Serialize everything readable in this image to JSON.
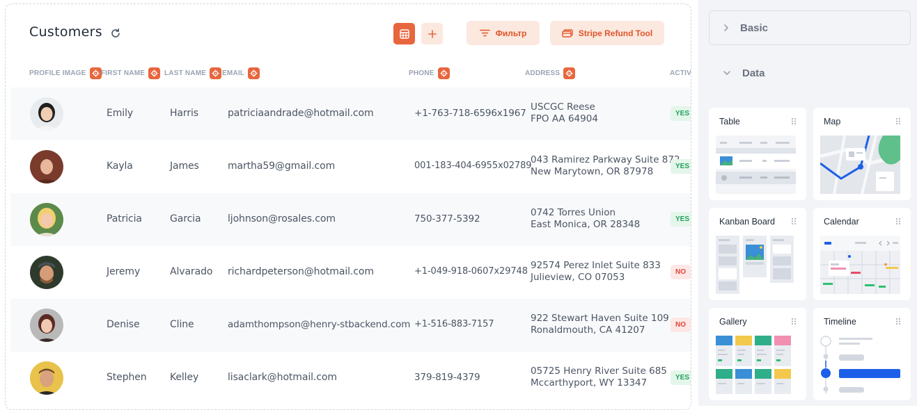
{
  "header": {
    "title": "Customers",
    "filter_label": "Фильтр",
    "stripe_label": "Stripe Refund Tool"
  },
  "table": {
    "columns": [
      "PROFILE IMAGE",
      "FIRST NAME",
      "LAST NAME",
      "EMAIL",
      "PHONE",
      "ADDRESS",
      "ACTIV"
    ],
    "rows": [
      {
        "first": "Emily",
        "last": "Harris",
        "email": "patriciaandrade@hotmail.com",
        "phone": "+1-763-718-6596x1967",
        "addr1": "USCGC Reese",
        "addr2": "FPO AA 64904",
        "active": "YES"
      },
      {
        "first": "Kayla",
        "last": "James",
        "email": "martha59@gmail.com",
        "phone": "001-183-404-6955x02789",
        "addr1": "043 Ramirez Parkway Suite 872",
        "addr2": "New Marytown, OR 87978",
        "active": "YES"
      },
      {
        "first": "Patricia",
        "last": "Garcia",
        "email": "ljohnson@rosales.com",
        "phone": "750-377-5392",
        "addr1": "0742 Torres Union",
        "addr2": "East Monica, OR 28348",
        "active": "YES"
      },
      {
        "first": "Jeremy",
        "last": "Alvarado",
        "email": "richardpeterson@hotmail.com",
        "phone": "+1-049-918-0607x29748",
        "addr1": "92574 Perez Inlet Suite 833",
        "addr2": "Julieview, CO 07053",
        "active": "NO"
      },
      {
        "first": "Denise",
        "last": "Cline",
        "email": "adamthompson@henry-stbackend.com",
        "phone": "+1-516-883-7157",
        "addr1": "922 Stewart Haven Suite 109",
        "addr2": "Ronaldmouth, CA 41207",
        "active": "NO"
      },
      {
        "first": "Stephen",
        "last": "Kelley",
        "email": "lisaclark@hotmail.com",
        "phone": "379-819-4379",
        "addr1": "05725 Henry River Suite 685",
        "addr2": "Mccarthyport, WY 13347",
        "active": "YES"
      }
    ]
  },
  "sidebar": {
    "basic_label": "Basic",
    "data_label": "Data",
    "cards": [
      "Table",
      "Map",
      "Kanban Board",
      "Calendar",
      "Gallery",
      "Timeline"
    ]
  },
  "colors": {
    "accent": "#e8663d",
    "accent_soft": "#fbe8df",
    "yes": "#22a05a",
    "no": "#e0453a"
  }
}
